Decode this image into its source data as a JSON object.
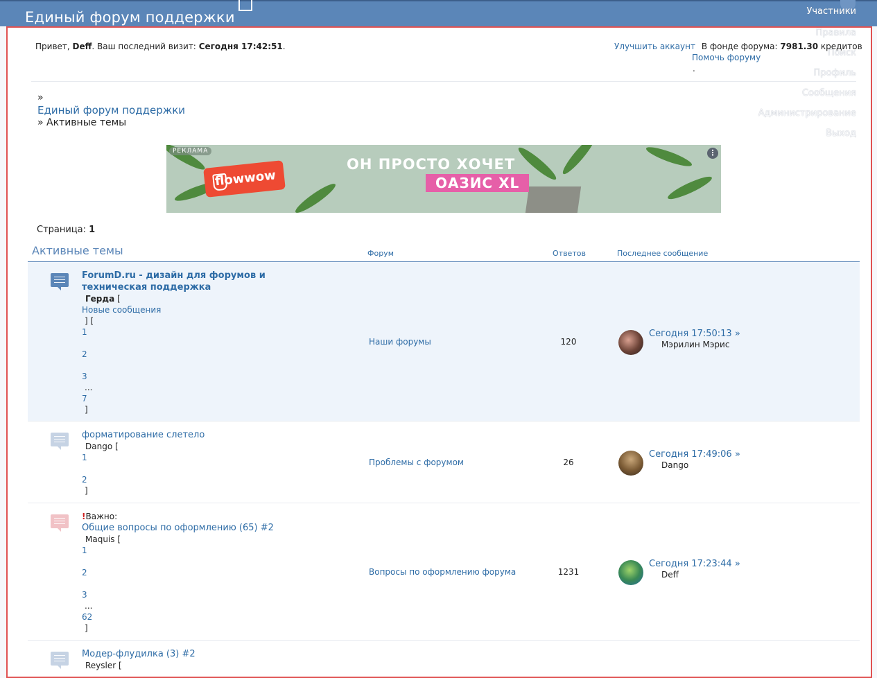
{
  "header": {
    "title": "Единый форум поддержки",
    "nav": [
      "Участники",
      "Правила",
      "Поиск",
      "Профиль",
      "Сообщения",
      "Администрирование",
      "Выход"
    ]
  },
  "greeting": {
    "hello": "Привет,",
    "user": "Deff",
    "last_visit_label": ". Ваш последний визит:",
    "last_visit_value": "Сегодня 17:42:51",
    "end": "."
  },
  "fund": {
    "upgrade": "Улучшить аккаунт",
    "label": "В фонде форума:",
    "value": "7981.30",
    "unit": "кредитов",
    "help": "Помочь форуму",
    "dot": "."
  },
  "breadcrumb": {
    "arrow": "»",
    "forum": "Единый форум поддержки",
    "current": "» Активные темы"
  },
  "ad": {
    "tag": "РЕКЛАМА",
    "brand": "flowwow",
    "line1": "ОН ПРОСТО ХОЧЕТ",
    "line2": "ОАЗИС XL"
  },
  "pagination": {
    "label": "Страница:",
    "current": "1"
  },
  "table": {
    "title": "Активные темы",
    "col_forum": "Форум",
    "col_replies": "Ответов",
    "col_last": "Последнее сообщение"
  },
  "topics": [
    {
      "title": "ForumD.ru - дизайн для форумов и техническая поддержка",
      "author": "Герда",
      "new_label": "Новые сообщения",
      "forum": "Наши форумы",
      "replies": "120",
      "last_time": "Сегодня 17:50:13",
      "last_user": "Мэрилин Мэрис",
      "pages": [
        "1",
        "2",
        "3",
        "...",
        "7"
      ]
    },
    {
      "title": "форматирование слетело",
      "author": "Dango",
      "forum": "Проблемы с форумом",
      "replies": "26",
      "last_time": "Сегодня 17:49:06",
      "last_user": "Dango",
      "pages": [
        "1",
        "2"
      ]
    },
    {
      "important": "Важно:",
      "title": "Общие вопросы по оформлению (65) #2",
      "author": "Maquis",
      "forum": "Вопросы по оформлению форума",
      "replies": "1231",
      "last_time": "Сегодня 17:23:44",
      "last_user": "Deff",
      "pages": [
        "1",
        "2",
        "3",
        "...",
        "62"
      ]
    },
    {
      "title": "Модер-флудилка (3) #2",
      "author": "Reysler"
    }
  ],
  "symbols": {
    "open_bracket": "[",
    "close_bracket": "]",
    "bracket_pair": "] [",
    "raquo": "»",
    "important_mark": "!"
  },
  "colors": {
    "header": "#5b86b8",
    "link": "#2e6ca6",
    "frame": "#e05252",
    "highlight_row": "#eef4fb"
  }
}
